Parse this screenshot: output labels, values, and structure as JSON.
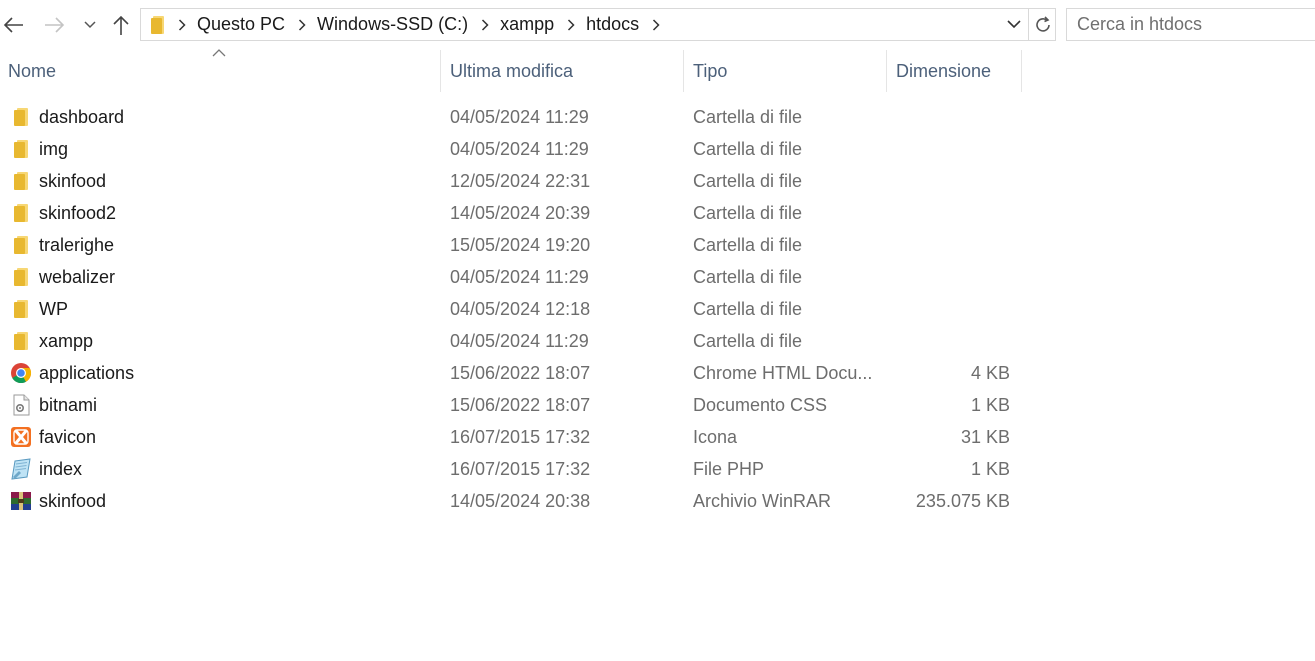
{
  "breadcrumb": [
    "Questo PC",
    "Windows-SSD (C:)",
    "xampp",
    "htdocs"
  ],
  "search": {
    "placeholder": "Cerca in htdocs"
  },
  "columns": {
    "name": "Nome",
    "modified": "Ultima modifica",
    "type": "Tipo",
    "size": "Dimensione"
  },
  "sort": {
    "column": "name",
    "direction": "ascending"
  },
  "files": [
    {
      "name": "dashboard",
      "modified": "04/05/2024 11:29",
      "type": "Cartella di file",
      "size": "",
      "icon": "folder-icon"
    },
    {
      "name": "img",
      "modified": "04/05/2024 11:29",
      "type": "Cartella di file",
      "size": "",
      "icon": "folder-icon"
    },
    {
      "name": "skinfood",
      "modified": "12/05/2024 22:31",
      "type": "Cartella di file",
      "size": "",
      "icon": "folder-icon"
    },
    {
      "name": "skinfood2",
      "modified": "14/05/2024 20:39",
      "type": "Cartella di file",
      "size": "",
      "icon": "folder-icon"
    },
    {
      "name": "tralerighe",
      "modified": "15/05/2024 19:20",
      "type": "Cartella di file",
      "size": "",
      "icon": "folder-icon"
    },
    {
      "name": "webalizer",
      "modified": "04/05/2024 11:29",
      "type": "Cartella di file",
      "size": "",
      "icon": "folder-icon"
    },
    {
      "name": "WP",
      "modified": "04/05/2024 12:18",
      "type": "Cartella di file",
      "size": "",
      "icon": "folder-icon"
    },
    {
      "name": "xampp",
      "modified": "04/05/2024 11:29",
      "type": "Cartella di file",
      "size": "",
      "icon": "folder-icon"
    },
    {
      "name": "applications",
      "modified": "15/06/2022 18:07",
      "type": "Chrome HTML Docu...",
      "size": "4 KB",
      "icon": "chrome-icon"
    },
    {
      "name": "bitnami",
      "modified": "15/06/2022 18:07",
      "type": "Documento CSS",
      "size": "1 KB",
      "icon": "css-file-icon"
    },
    {
      "name": "favicon",
      "modified": "16/07/2015 17:32",
      "type": "Icona",
      "size": "31 KB",
      "icon": "xampp-icon"
    },
    {
      "name": "index",
      "modified": "16/07/2015 17:32",
      "type": "File PHP",
      "size": "1 KB",
      "icon": "php-file-icon"
    },
    {
      "name": "skinfood",
      "modified": "14/05/2024 20:38",
      "type": "Archivio WinRAR",
      "size": "235.075 KB",
      "icon": "winrar-icon"
    }
  ],
  "colors": {
    "header_text": "#4c607a",
    "secondary_text": "#6d6d6d",
    "folder": "#f2c94c"
  }
}
